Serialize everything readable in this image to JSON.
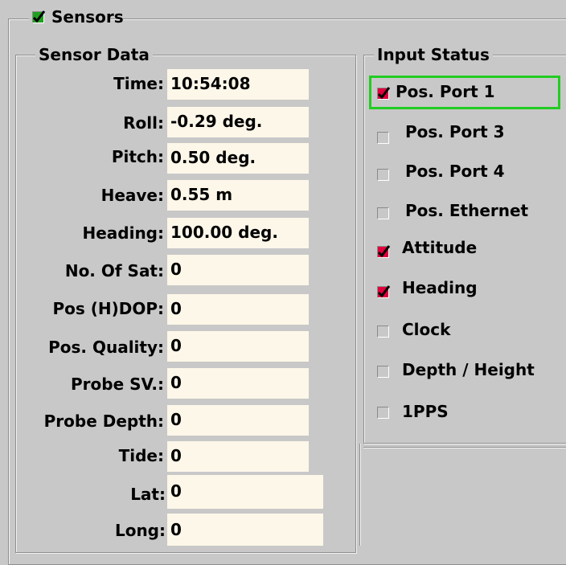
{
  "sensors_group": {
    "title": "Sensors",
    "checked": true
  },
  "sensor_data": {
    "title": "Sensor Data",
    "rows": [
      {
        "label": "Time:",
        "value": "10:54:08"
      },
      {
        "label": "Roll:",
        "value": "-0.29 deg."
      },
      {
        "label": "Pitch:",
        "value": "0.50 deg."
      },
      {
        "label": "Heave:",
        "value": "0.55 m"
      },
      {
        "label": "Heading:",
        "value": "100.00 deg."
      },
      {
        "label": "No. Of Sat:",
        "value": "0"
      },
      {
        "label": "Pos (H)DOP:",
        "value": "0"
      },
      {
        "label": "Pos. Quality:",
        "value": "0"
      },
      {
        "label": "Probe SV.:",
        "value": "0"
      },
      {
        "label": "Probe Depth:",
        "value": "0"
      },
      {
        "label": "Tide:",
        "value": "0"
      },
      {
        "label": "Lat:",
        "value": "0"
      },
      {
        "label": "Long:",
        "value": "0"
      }
    ]
  },
  "input_status": {
    "title": "Input Status",
    "items": [
      {
        "label": "Pos. Port 1",
        "checked": true,
        "focused": true
      },
      {
        "label": "Pos. Port 3",
        "checked": false
      },
      {
        "label": "Pos. Port 4",
        "checked": false
      },
      {
        "label": "Pos. Ethernet",
        "checked": false
      },
      {
        "label": "Attitude",
        "checked": true
      },
      {
        "label": "Heading",
        "checked": true
      },
      {
        "label": "Clock",
        "checked": false
      },
      {
        "label": "Depth / Height",
        "checked": false
      },
      {
        "label": "1PPS",
        "checked": false
      }
    ]
  },
  "colors": {
    "background": "#c8c8c8",
    "field": "#fdf7e9",
    "check_red": "#e0003c",
    "check_green": "#1ea01e",
    "focus": "#22cc22"
  }
}
